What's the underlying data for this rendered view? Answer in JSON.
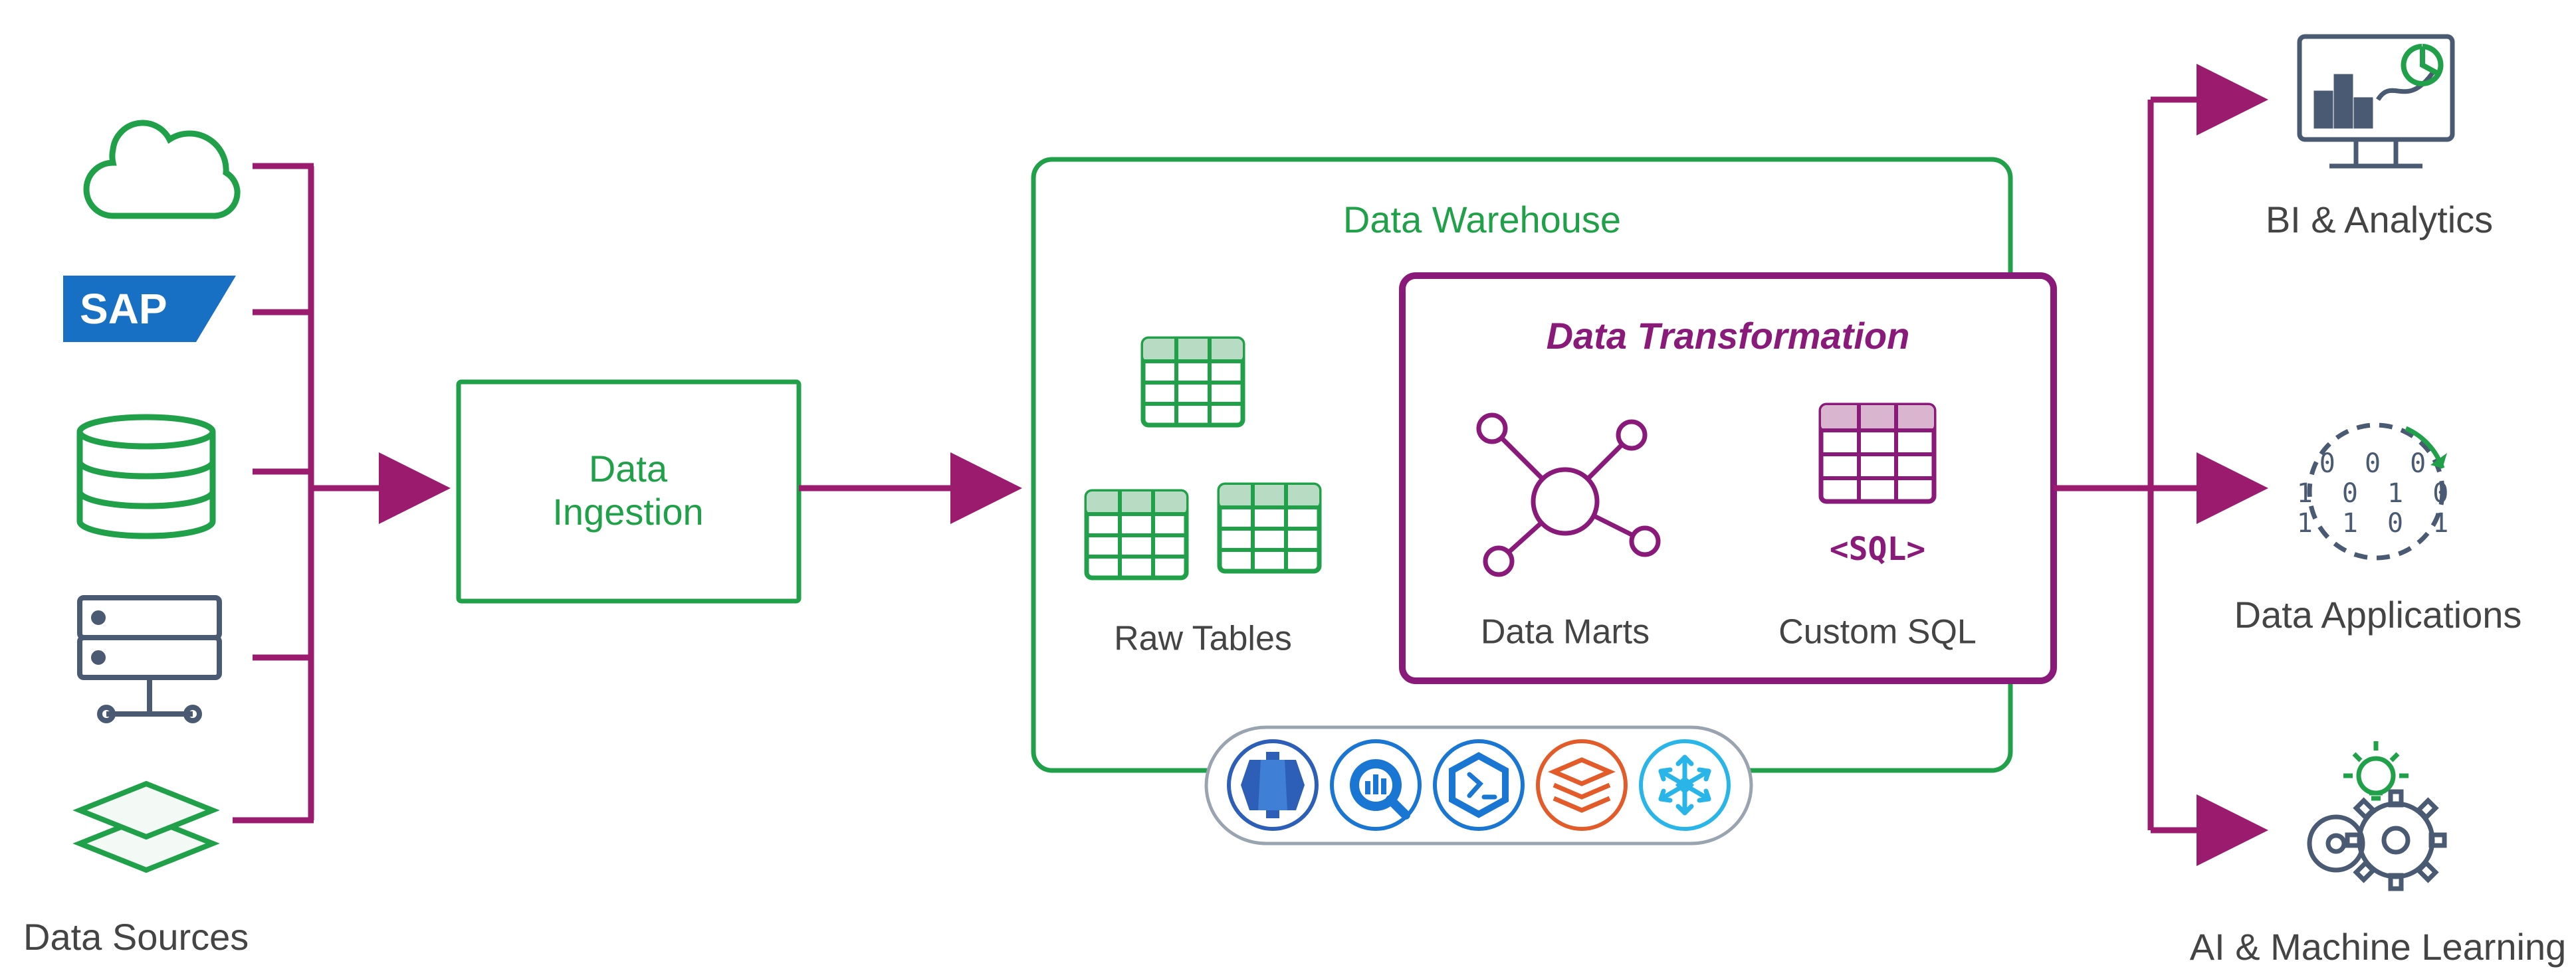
{
  "labels": {
    "data_sources": "Data Sources",
    "data_ingestion": "Data\nIngestion",
    "data_warehouse": "Data Warehouse",
    "raw_tables": "Raw Tables",
    "data_transformation": "Data Transformation",
    "data_marts": "Data Marts",
    "custom_sql": "Custom SQL",
    "sql_tag": "<SQL>",
    "bi_analytics": "BI & Analytics",
    "data_applications": "Data Applications",
    "ai_ml": "AI & Machine Learning",
    "sap": "SAP",
    "binary_row1": "0 0 0",
    "binary_row2": "1 0 1 0",
    "binary_row3": "1 1 0 1"
  },
  "flow": {
    "sources": [
      "cloud",
      "sap",
      "database",
      "server",
      "layers"
    ],
    "stages": [
      "Data Ingestion",
      "Data Warehouse",
      "Data Transformation"
    ],
    "outputs": [
      "BI & Analytics",
      "Data Applications",
      "AI & Machine Learning"
    ],
    "warehouse_vendors": [
      "Redshift",
      "BigQuery",
      "Synapse",
      "Databricks",
      "Snowflake"
    ]
  }
}
